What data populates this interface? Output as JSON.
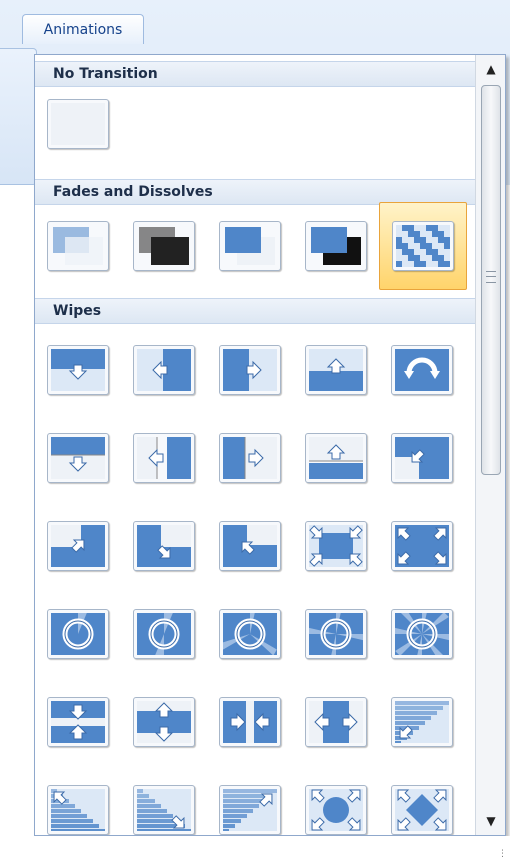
{
  "tab": {
    "label": "Animations"
  },
  "gallery": {
    "sections": [
      {
        "title": "No Transition",
        "items": [
          {
            "name": "no-transition",
            "selected": false
          }
        ]
      },
      {
        "title": "Fades and Dissolves",
        "items": [
          {
            "name": "fade-smoothly",
            "selected": false
          },
          {
            "name": "fade-through-black",
            "selected": false
          },
          {
            "name": "fade-smoothly-alt",
            "selected": false
          },
          {
            "name": "fade-through-black-alt",
            "selected": false
          },
          {
            "name": "dissolve",
            "selected": true
          }
        ]
      },
      {
        "title": "Wipes",
        "items": [
          {
            "name": "wipe-down"
          },
          {
            "name": "wipe-left"
          },
          {
            "name": "wipe-right"
          },
          {
            "name": "wipe-up"
          },
          {
            "name": "wheel-clockwise"
          },
          {
            "name": "push-down"
          },
          {
            "name": "push-left"
          },
          {
            "name": "push-right"
          },
          {
            "name": "push-up"
          },
          {
            "name": "cover-left-down"
          },
          {
            "name": "cover-right-up"
          },
          {
            "name": "uncover-left-down"
          },
          {
            "name": "uncover-right-up"
          },
          {
            "name": "box-in"
          },
          {
            "name": "box-out"
          },
          {
            "name": "wheel-1-spoke"
          },
          {
            "name": "wheel-2-spokes"
          },
          {
            "name": "wheel-3-spokes"
          },
          {
            "name": "wheel-4-spokes"
          },
          {
            "name": "wheel-8-spokes"
          },
          {
            "name": "split-horizontal-in"
          },
          {
            "name": "split-horizontal-out"
          },
          {
            "name": "split-vertical-in"
          },
          {
            "name": "split-vertical-out"
          },
          {
            "name": "strips-left-down"
          },
          {
            "name": "strips-left-up"
          },
          {
            "name": "strips-right-up"
          },
          {
            "name": "strips-right-down"
          },
          {
            "name": "circle"
          },
          {
            "name": "diamond"
          }
        ]
      }
    ]
  },
  "colors": {
    "tile_blue": "#4f86c9",
    "tile_light": "#dce8f6",
    "selected_bg": "#ffd46b",
    "header_text": "#1e2f4a"
  }
}
